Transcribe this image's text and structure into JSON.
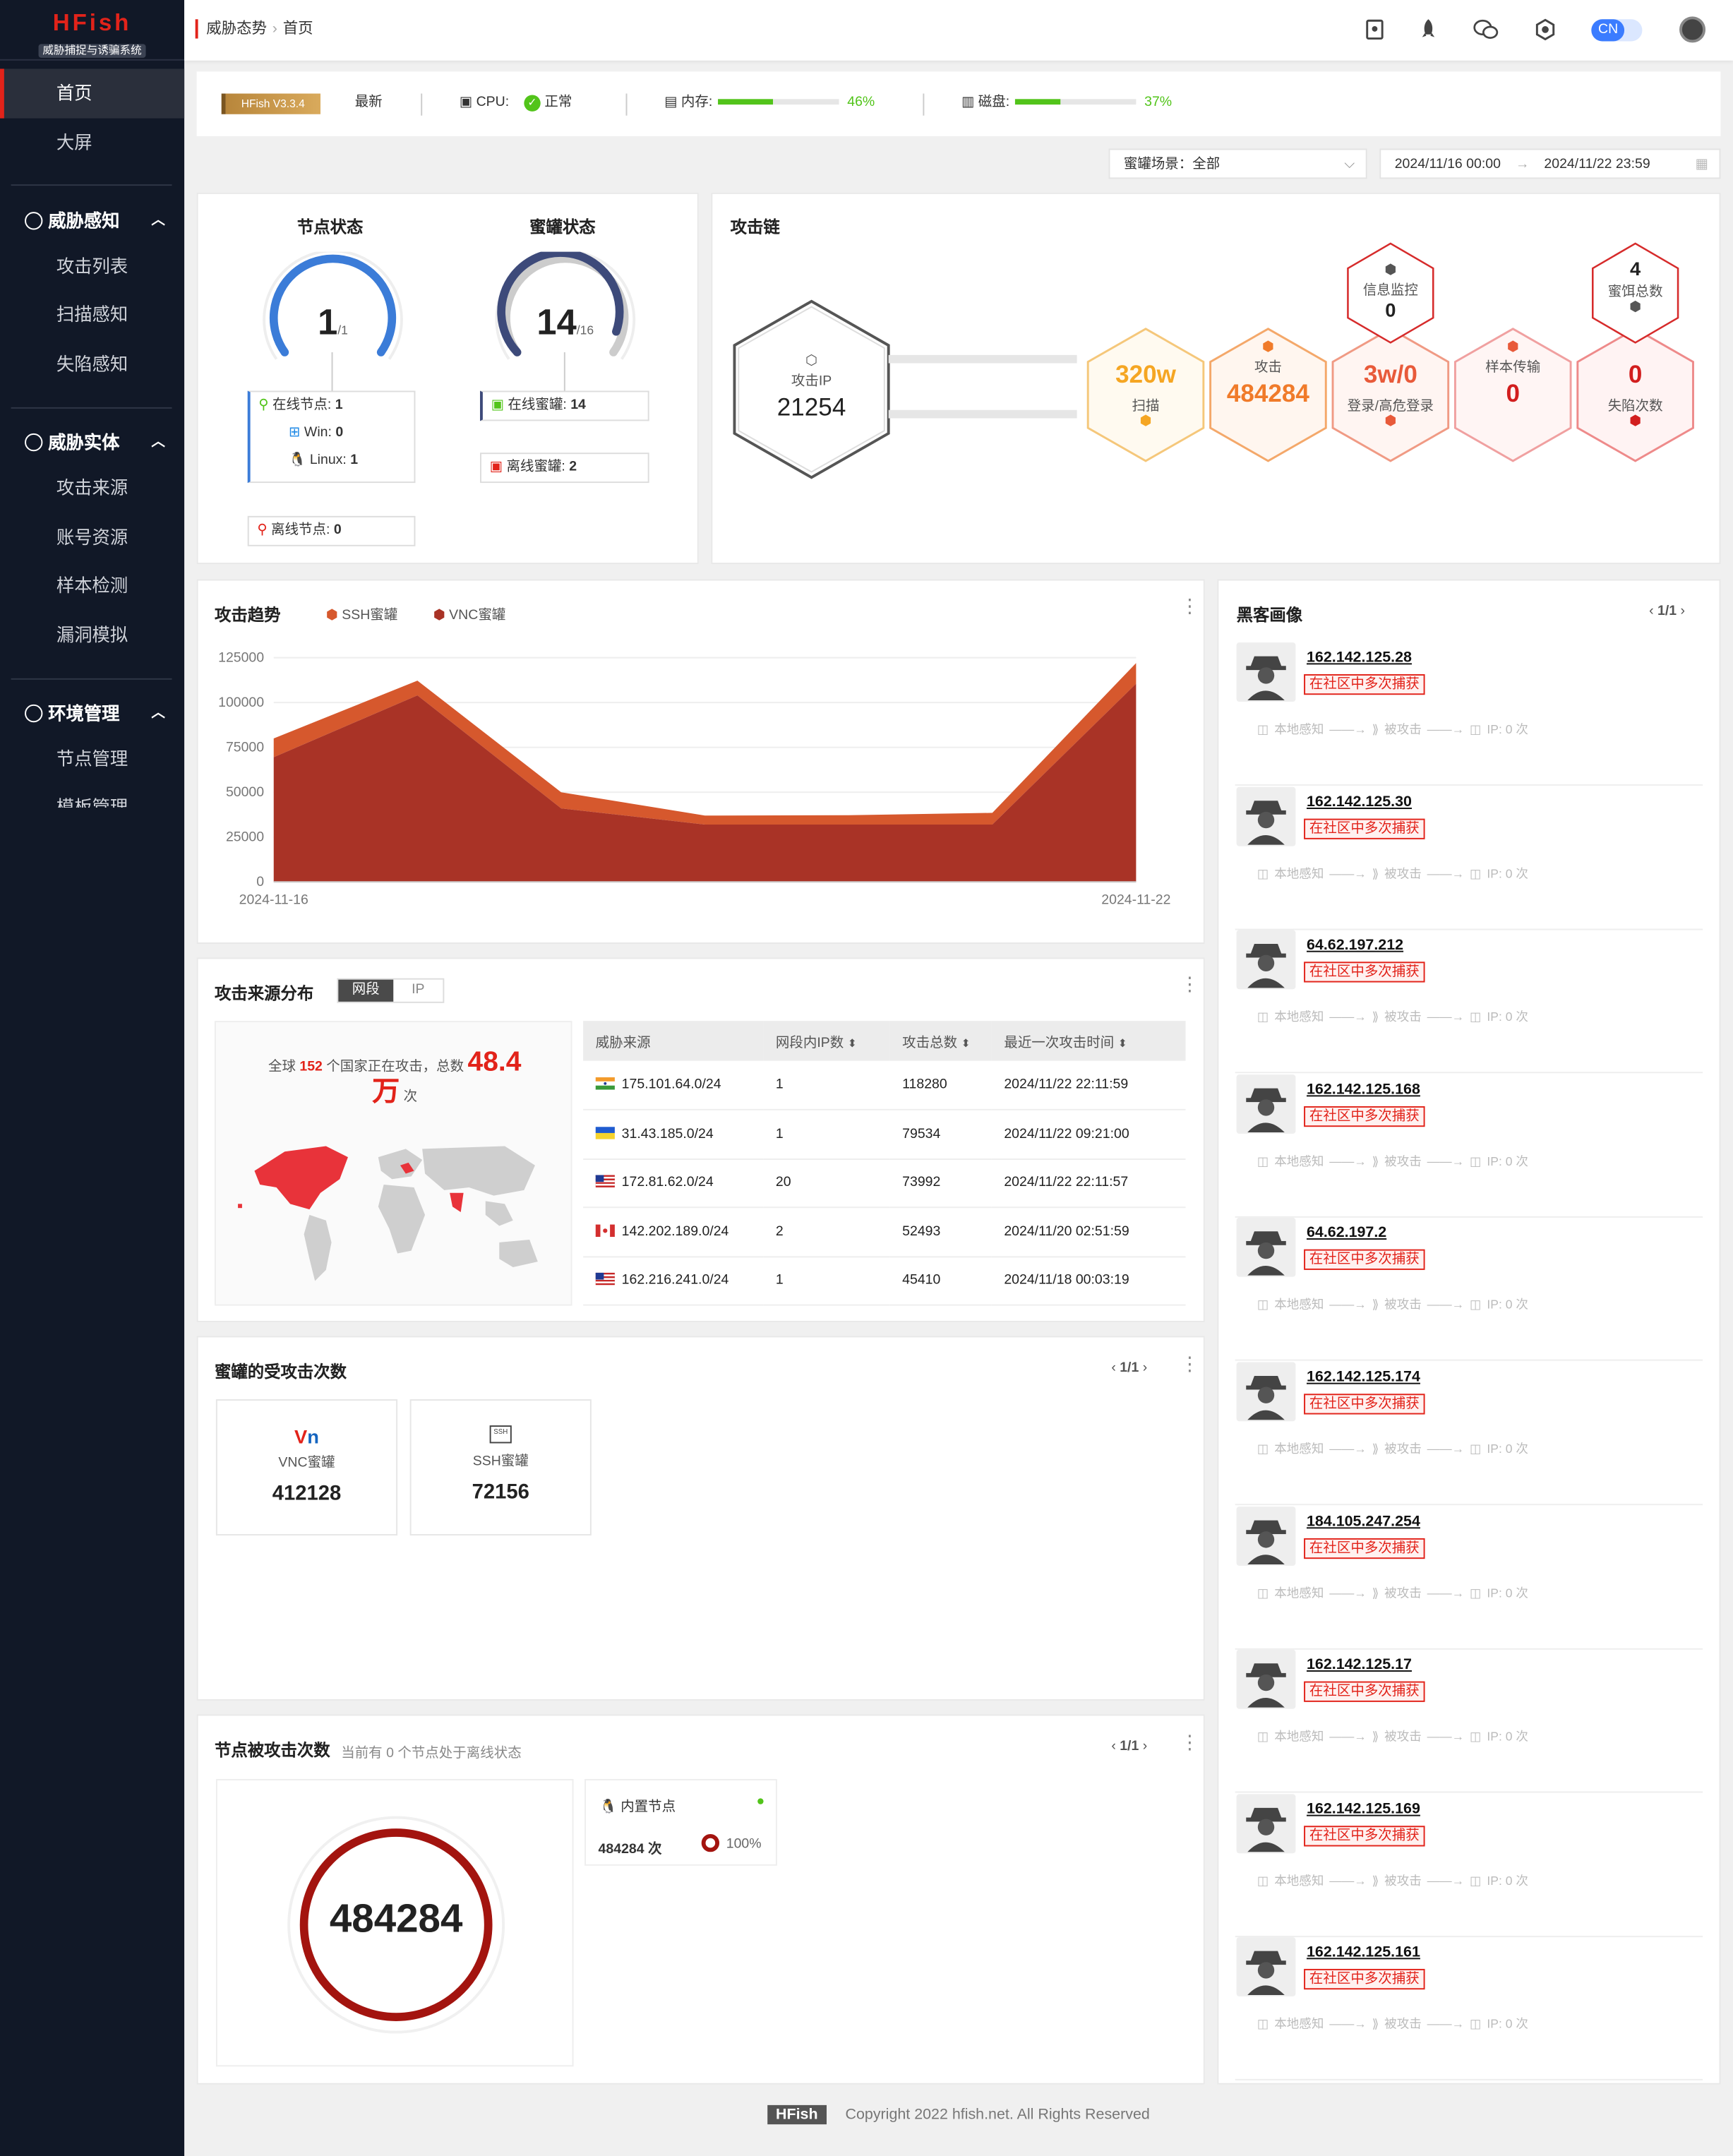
{
  "app": {
    "name": "HFish",
    "subtitle": "威胁捕捉与诱骗系统"
  },
  "breadcrumb": {
    "parent": "威胁态势",
    "current": "首页"
  },
  "header": {
    "lang": "CN"
  },
  "sidebar": {
    "home": "首页",
    "bigscreen": "大屏",
    "groups": [
      {
        "label": "威胁感知",
        "items": [
          "攻击列表",
          "扫描感知",
          "失陷感知"
        ]
      },
      {
        "label": "威胁实体",
        "items": [
          "攻击来源",
          "账号资源",
          "样本检测",
          "漏洞模拟"
        ]
      },
      {
        "label": "环境管理",
        "items": [
          "节点管理",
          "模板管理"
        ]
      }
    ]
  },
  "status": {
    "version": "HFish V3.3.4",
    "latest": "最新",
    "cpu_label": "CPU:",
    "cpu_status": "正常",
    "mem_label": "内存:",
    "mem_value": "46%",
    "mem_level": 0.46,
    "disk_label": "磁盘:",
    "disk_value": "37%",
    "disk_level": 0.37
  },
  "filters": {
    "scene_label": "蜜罐场景：全部",
    "date_start": "2024/11/16 00:00",
    "date_end": "2024/11/22 23:59"
  },
  "nodes": {
    "title": "节点状态",
    "online": "1",
    "total": "/1",
    "online_label": "在线节点:",
    "online_count": "1",
    "win_label": "Win:",
    "win_count": "0",
    "linux_label": "Linux:",
    "linux_count": "1",
    "offline_label": "离线节点:",
    "offline_count": "0"
  },
  "honeypots": {
    "title": "蜜罐状态",
    "online": "14",
    "total": "/16",
    "online_label": "在线蜜罐:",
    "online_count": "14",
    "offline_label": "离线蜜罐:",
    "offline_count": "2"
  },
  "chain": {
    "title": "攻击链",
    "attack_ip_label": "攻击IP",
    "attack_ip": "21254",
    "scan_value": "320w",
    "scan_label": "扫描",
    "attack_label": "攻击",
    "attack_value": "484284",
    "login_value": "3w/0",
    "login_label": "登录/高危登录",
    "info_label": "信息监控",
    "info_value": "0",
    "sample_label": "样本传输",
    "sample_value": "0",
    "bait_value": "4",
    "bait_label": "蜜饵总数",
    "lost_value": "0",
    "lost_label": "失陷次数"
  },
  "trend": {
    "title": "攻击趋势",
    "legend": [
      "SSH蜜罐",
      "VNC蜜罐"
    ]
  },
  "chart_data": {
    "type": "area",
    "title": "攻击趋势",
    "x": [
      "2024-11-16",
      "2024-11-17",
      "2024-11-18",
      "2024-11-19",
      "2024-11-20",
      "2024-11-21",
      "2024-11-22"
    ],
    "xticks": [
      "2024-11-16",
      "2024-11-22"
    ],
    "yticks": [
      "125000",
      "100000",
      "75000",
      "50000",
      "25000",
      "0"
    ],
    "ylim": [
      0,
      125000
    ],
    "series": [
      {
        "name": "SSH蜜罐",
        "color": "#d6582d",
        "values": [
          10500,
          8200,
          9000,
          5000,
          5200,
          6500,
          11500
        ]
      },
      {
        "name": "VNC蜜罐",
        "color": "#a93326",
        "values": [
          69500,
          104000,
          41000,
          32000,
          32000,
          32000,
          110500
        ]
      }
    ]
  },
  "source": {
    "title": "攻击来源分布",
    "tab_active": "网段",
    "tab_other": "IP",
    "summary_prefix": "全球",
    "countries": "152",
    "summary_mid": "个国家正在攻击，总数",
    "total": "48.4",
    "unit": "万",
    "suffix": "次",
    "headers": [
      "威胁来源",
      "网段内IP数",
      "攻击总数",
      "最近一次攻击时间"
    ],
    "rows": [
      {
        "flag": "in",
        "net": "175.101.64.0/24",
        "ips": "1",
        "total": "118280",
        "time": "2024/11/22 22:11:59"
      },
      {
        "flag": "ua",
        "net": "31.43.185.0/24",
        "ips": "1",
        "total": "79534",
        "time": "2024/11/22 09:21:00"
      },
      {
        "flag": "us",
        "net": "172.81.62.0/24",
        "ips": "20",
        "total": "73992",
        "time": "2024/11/22 22:11:57"
      },
      {
        "flag": "ca",
        "net": "142.202.189.0/24",
        "ips": "2",
        "total": "52493",
        "time": "2024/11/20 02:51:59"
      },
      {
        "flag": "us",
        "net": "162.216.241.0/24",
        "ips": "1",
        "total": "45410",
        "time": "2024/11/18 00:03:19"
      }
    ]
  },
  "honeypot_hits": {
    "title": "蜜罐的受攻击次数",
    "pager": "1/1",
    "items": [
      {
        "icon": "vnc-icon",
        "label": "VNC蜜罐",
        "value": "412128"
      },
      {
        "icon": "ssh-icon",
        "label": "SSH蜜罐",
        "value": "72156"
      }
    ]
  },
  "node_hits": {
    "title": "节点被攻击次数",
    "note": "当前有 0 个节点处于离线状态",
    "pager": "1/1",
    "total": "484284",
    "node_name": "内置节点",
    "node_count": "484284 次",
    "node_pct": "100%"
  },
  "hackers": {
    "title": "黑客画像",
    "pager": "1/1",
    "tag": "在社区中多次捕获",
    "flow": [
      "本地感知",
      "被攻击",
      "IP: 0 次"
    ],
    "ips": [
      "162.142.125.28",
      "162.142.125.30",
      "64.62.197.212",
      "162.142.125.168",
      "64.62.197.2",
      "162.142.125.174",
      "184.105.247.254",
      "162.142.125.17",
      "162.142.125.169",
      "162.142.125.161"
    ]
  },
  "footer": {
    "brand": "HFish",
    "copyright": "Copyright 2022 hfish.net. All Rights Reserved"
  },
  "colors": {
    "accent": "#e2231a",
    "gauge_blue": "#3b7cd8",
    "gauge_navy": "#3d4a7a",
    "scan": "#f5a623",
    "attack": "#f07b2a",
    "login": "#e85a3a",
    "lost": "#d21e1e"
  }
}
